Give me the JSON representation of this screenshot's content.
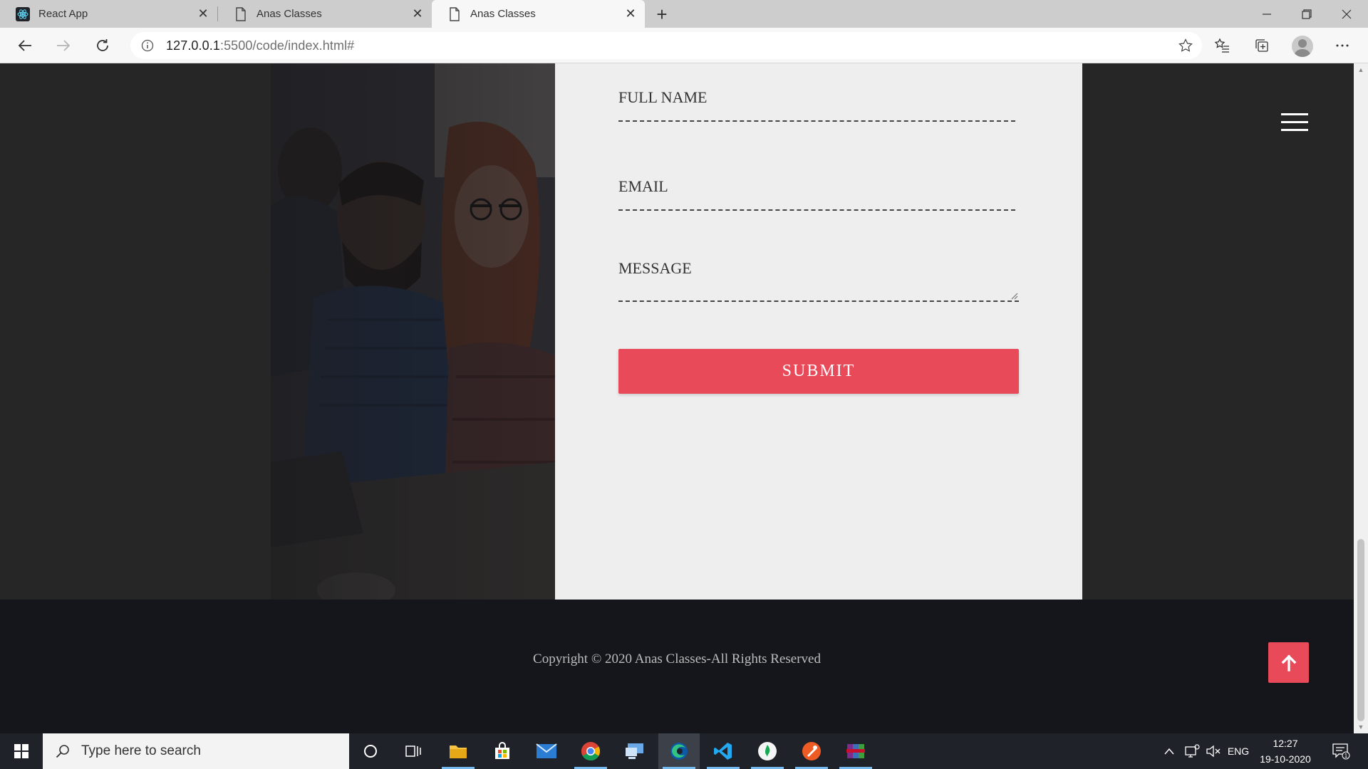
{
  "browser": {
    "tabs": [
      {
        "title": "React App",
        "icon": "react-icon",
        "active": false
      },
      {
        "title": "Anas Classes",
        "icon": "page-icon",
        "active": false
      },
      {
        "title": "Anas Classes",
        "icon": "page-icon",
        "active": true
      }
    ],
    "url_host": "127.0.0.1",
    "url_path": ":5500/code/index.html#"
  },
  "contact_form": {
    "full_name_label": "FULL NAME",
    "email_label": "EMAIL",
    "message_label": "MESSAGE",
    "submit_label": "SUBMIT"
  },
  "footer": {
    "copyright": "Copyright © 2020 Anas Classes-All Rights Reserved"
  },
  "taskbar": {
    "search_placeholder": "Type here to search",
    "language": "ENG",
    "time": "12:27",
    "date": "19-10-2020",
    "notification_count": "1"
  },
  "colors": {
    "accent": "#e84a5a",
    "page_background": "#262626",
    "form_background": "#eeeeee",
    "footer_background": "#14161b"
  }
}
